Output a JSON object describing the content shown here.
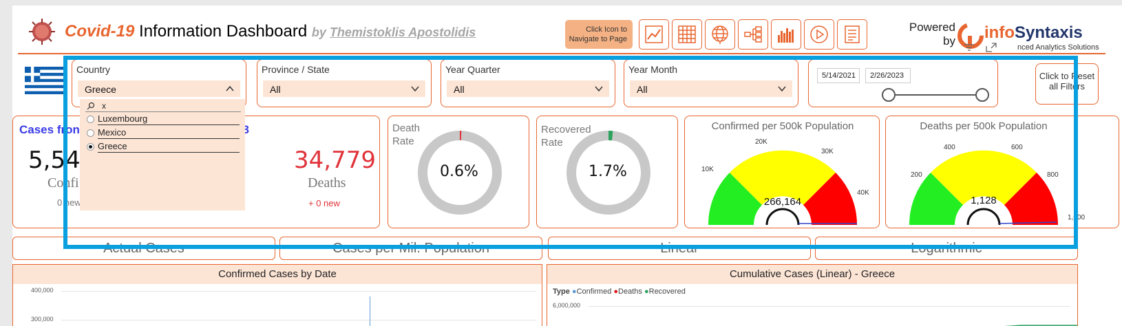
{
  "header": {
    "title_prefix": "Covid-19",
    "title_main": "Information Dashboard",
    "by": "by",
    "author": "Themistoklis Apostolidis",
    "nav_hint": "Click Icon to Navigate to Page",
    "powered": "Powered by",
    "brand_a": "info",
    "brand_b": "Syntaxis",
    "brand_sub": "nced Analytics Solutions",
    "nav_icons": [
      "line-chart-icon",
      "grid-table-icon",
      "globe-icon",
      "hierarchy-icon",
      "column-chart-icon",
      "play-icon",
      "report-icon"
    ]
  },
  "slicers": {
    "country": {
      "label": "Country",
      "value": "Greece"
    },
    "province": {
      "label": "Province / State",
      "value": "All"
    },
    "year_quarter": {
      "label": "Year Quarter",
      "value": "All"
    },
    "year_month": {
      "label": "Year Month",
      "value": "All"
    },
    "date_start": "5/14/2021",
    "date_end": "2/26/2023",
    "reset": "Click to Reset all Filters"
  },
  "dropdown": {
    "search": "x",
    "items": [
      {
        "label": "Luxembourg",
        "selected": false
      },
      {
        "label": "Mexico",
        "selected": false
      },
      {
        "label": "Greece",
        "selected": true
      }
    ]
  },
  "kpis": {
    "heading_left": "Cases fron",
    "heading_right": "23",
    "confirmed_value": "5,548",
    "confirmed_label": "Confi",
    "confirmed_new": "0 new",
    "deaths_value": "34,779",
    "deaths_label": "Deaths",
    "deaths_new": "+ 0 new"
  },
  "rates": {
    "death_label": "Death Rate",
    "death_value": "0.6%",
    "death_fraction": 0.006,
    "recovered_label": "Recovered Rate",
    "recovered_value": "1.7%",
    "recovered_fraction": 0.017
  },
  "gauges": {
    "confirmed": {
      "title": "Confirmed per 500k Population",
      "value": "266,164",
      "ticks": [
        "10K",
        "20K",
        "30K",
        "40K"
      ]
    },
    "deaths": {
      "title": "Deaths per 500k Population",
      "value": "1,128",
      "ticks": [
        "200",
        "400",
        "600",
        "800",
        "1,000"
      ]
    }
  },
  "tabs": [
    "Actual Cases",
    "Cases per Mil. Population",
    "Linear",
    "Logarithmic"
  ],
  "charts": {
    "left_title": "Confirmed Cases by Date",
    "left_ticks": [
      "400,000",
      "300,000"
    ],
    "right_title": "Cumulative Cases (Linear) - Greece",
    "legend_type": "Type",
    "legend": [
      {
        "name": "Confirmed",
        "color": "#5b9bd5"
      },
      {
        "name": "Deaths",
        "color": "#e31a1c"
      },
      {
        "name": "Recovered",
        "color": "#2ca25f"
      }
    ],
    "right_tick": "6,000,000"
  },
  "colors": {
    "accent": "#e8652f",
    "highlight": "#0aa0e0",
    "slicer_fill": "#fde5d6"
  }
}
